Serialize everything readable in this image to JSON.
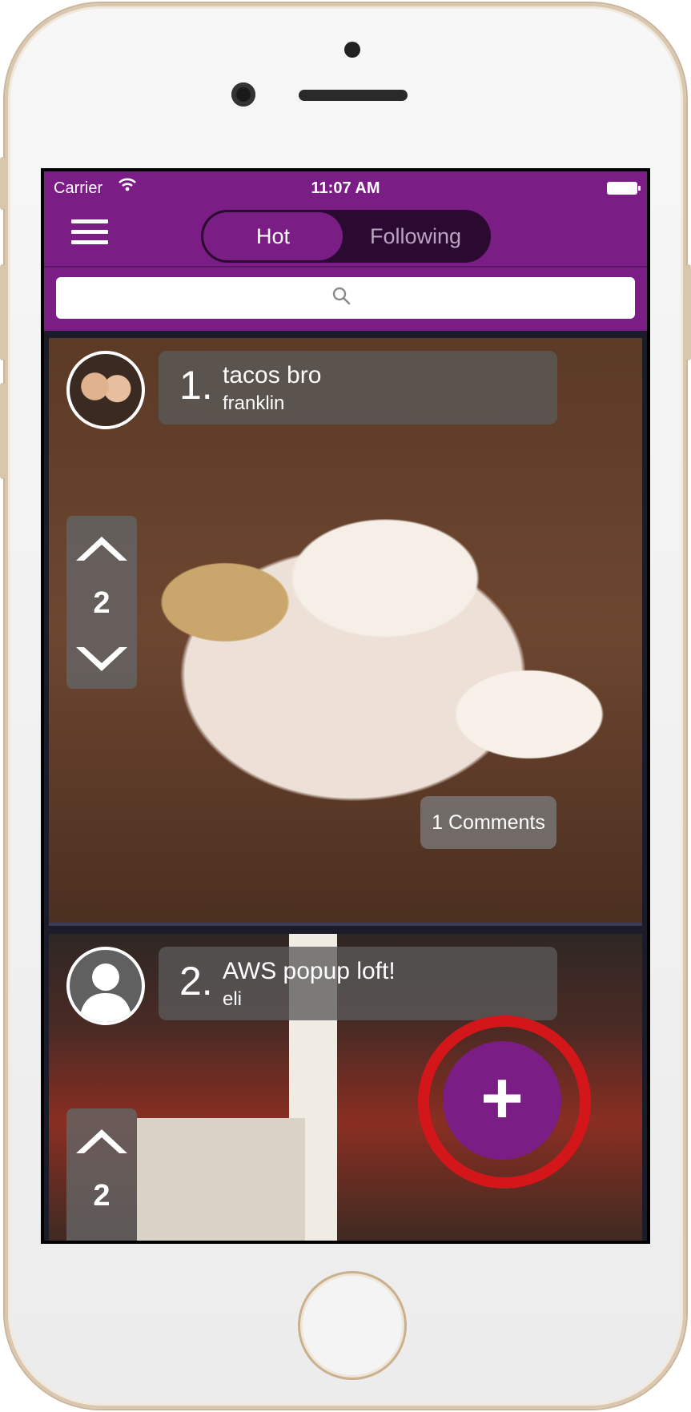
{
  "status_bar": {
    "carrier": "Carrier",
    "time": "11:07 AM"
  },
  "nav": {
    "tabs": [
      "Hot",
      "Following"
    ],
    "active_tab": "Hot"
  },
  "search": {
    "placeholder": ""
  },
  "posts": [
    {
      "rank": "1.",
      "title": "tacos bro",
      "author": "franklin",
      "votes": "2",
      "comments_label": "1 Comments"
    },
    {
      "rank": "2.",
      "title": "AWS popup loft!",
      "author": "eli",
      "votes": "2"
    }
  ],
  "colors": {
    "brand": "#7a1d84",
    "highlight_ring": "#d2161a"
  },
  "icons": [
    "menu-icon",
    "search-icon",
    "wifi-icon",
    "battery-icon",
    "upvote-icon",
    "downvote-icon",
    "user-placeholder-icon",
    "plus-icon"
  ]
}
